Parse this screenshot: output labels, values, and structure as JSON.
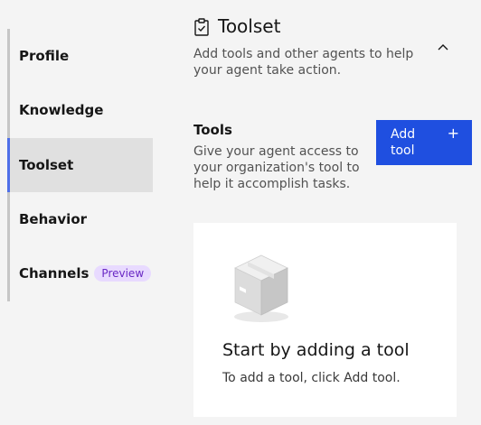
{
  "sidebar": {
    "items": [
      {
        "label": "Profile"
      },
      {
        "label": "Knowledge"
      },
      {
        "label": "Toolset"
      },
      {
        "label": "Behavior"
      },
      {
        "label": "Channels",
        "badge": "Preview"
      }
    ],
    "active": "Toolset"
  },
  "section": {
    "icon": "clipboard-check-icon",
    "title": "Toolset",
    "description": "Add tools and other agents to help your agent take action.",
    "collapse_icon": "chevron-up-icon"
  },
  "tools": {
    "heading": "Tools",
    "description": "Give your agent access to your organization's tool to help it accomplish tasks.",
    "add_button": {
      "label": "Add tool",
      "icon": "plus-icon"
    }
  },
  "empty_state": {
    "illustration": "box-icon",
    "title": "Start by adding a tool",
    "description": "To add a tool, click Add tool."
  },
  "colors": {
    "accent": "#1f4fe0",
    "active_indicator": "#4f6fe8",
    "badge_bg": "#e8daff",
    "badge_text": "#6929c4",
    "background": "#f4f4f4"
  }
}
